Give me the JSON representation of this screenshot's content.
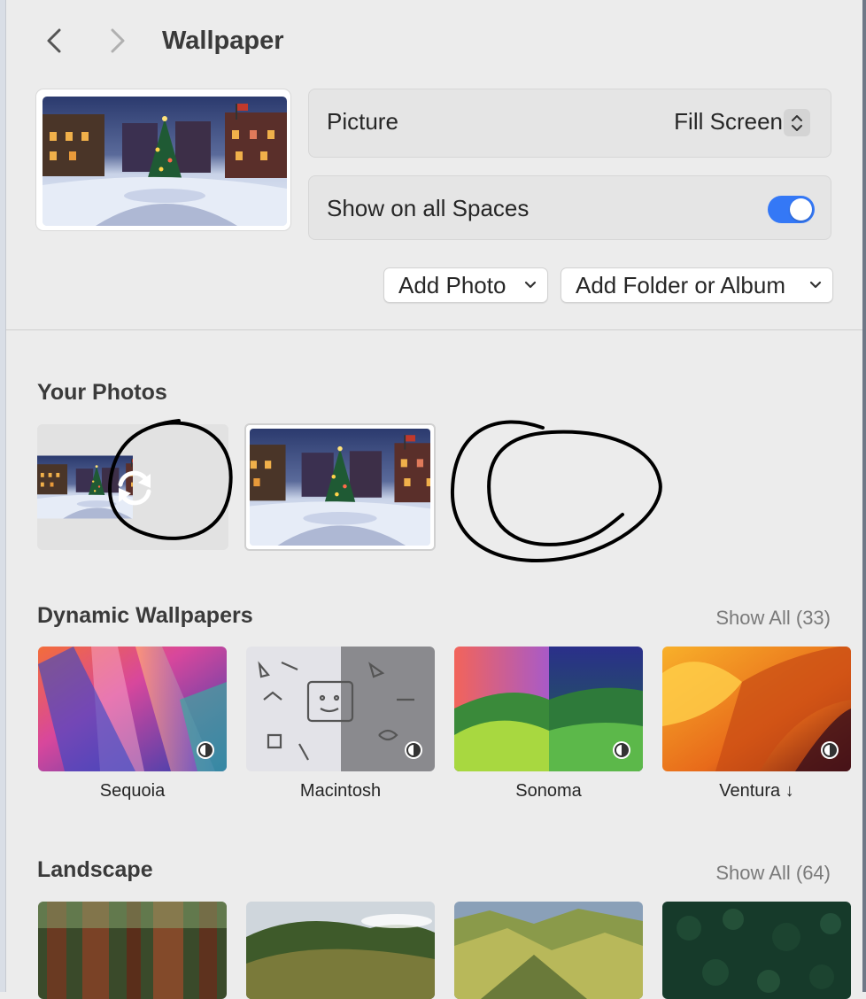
{
  "header": {
    "title": "Wallpaper",
    "back_icon": "chevron-left-icon",
    "forward_icon": "chevron-right-icon"
  },
  "current": {
    "picture_label": "Picture",
    "picture_value": "Fill Screen",
    "spaces_label": "Show on all Spaces",
    "spaces_enabled": true
  },
  "buttons": {
    "add_photo": "Add Photo",
    "add_folder": "Add Folder or Album"
  },
  "your_photos": {
    "title": "Your Photos"
  },
  "dynamic": {
    "title": "Dynamic Wallpapers",
    "show_all": "Show All (33)",
    "items": [
      {
        "label": "Sequoia"
      },
      {
        "label": "Macintosh"
      },
      {
        "label": "Sonoma"
      },
      {
        "label": "Ventura ↓"
      }
    ]
  },
  "landscape": {
    "title": "Landscape",
    "show_all": "Show All (64)"
  },
  "colors": {
    "accent": "#3478f6",
    "background": "#ececec"
  }
}
